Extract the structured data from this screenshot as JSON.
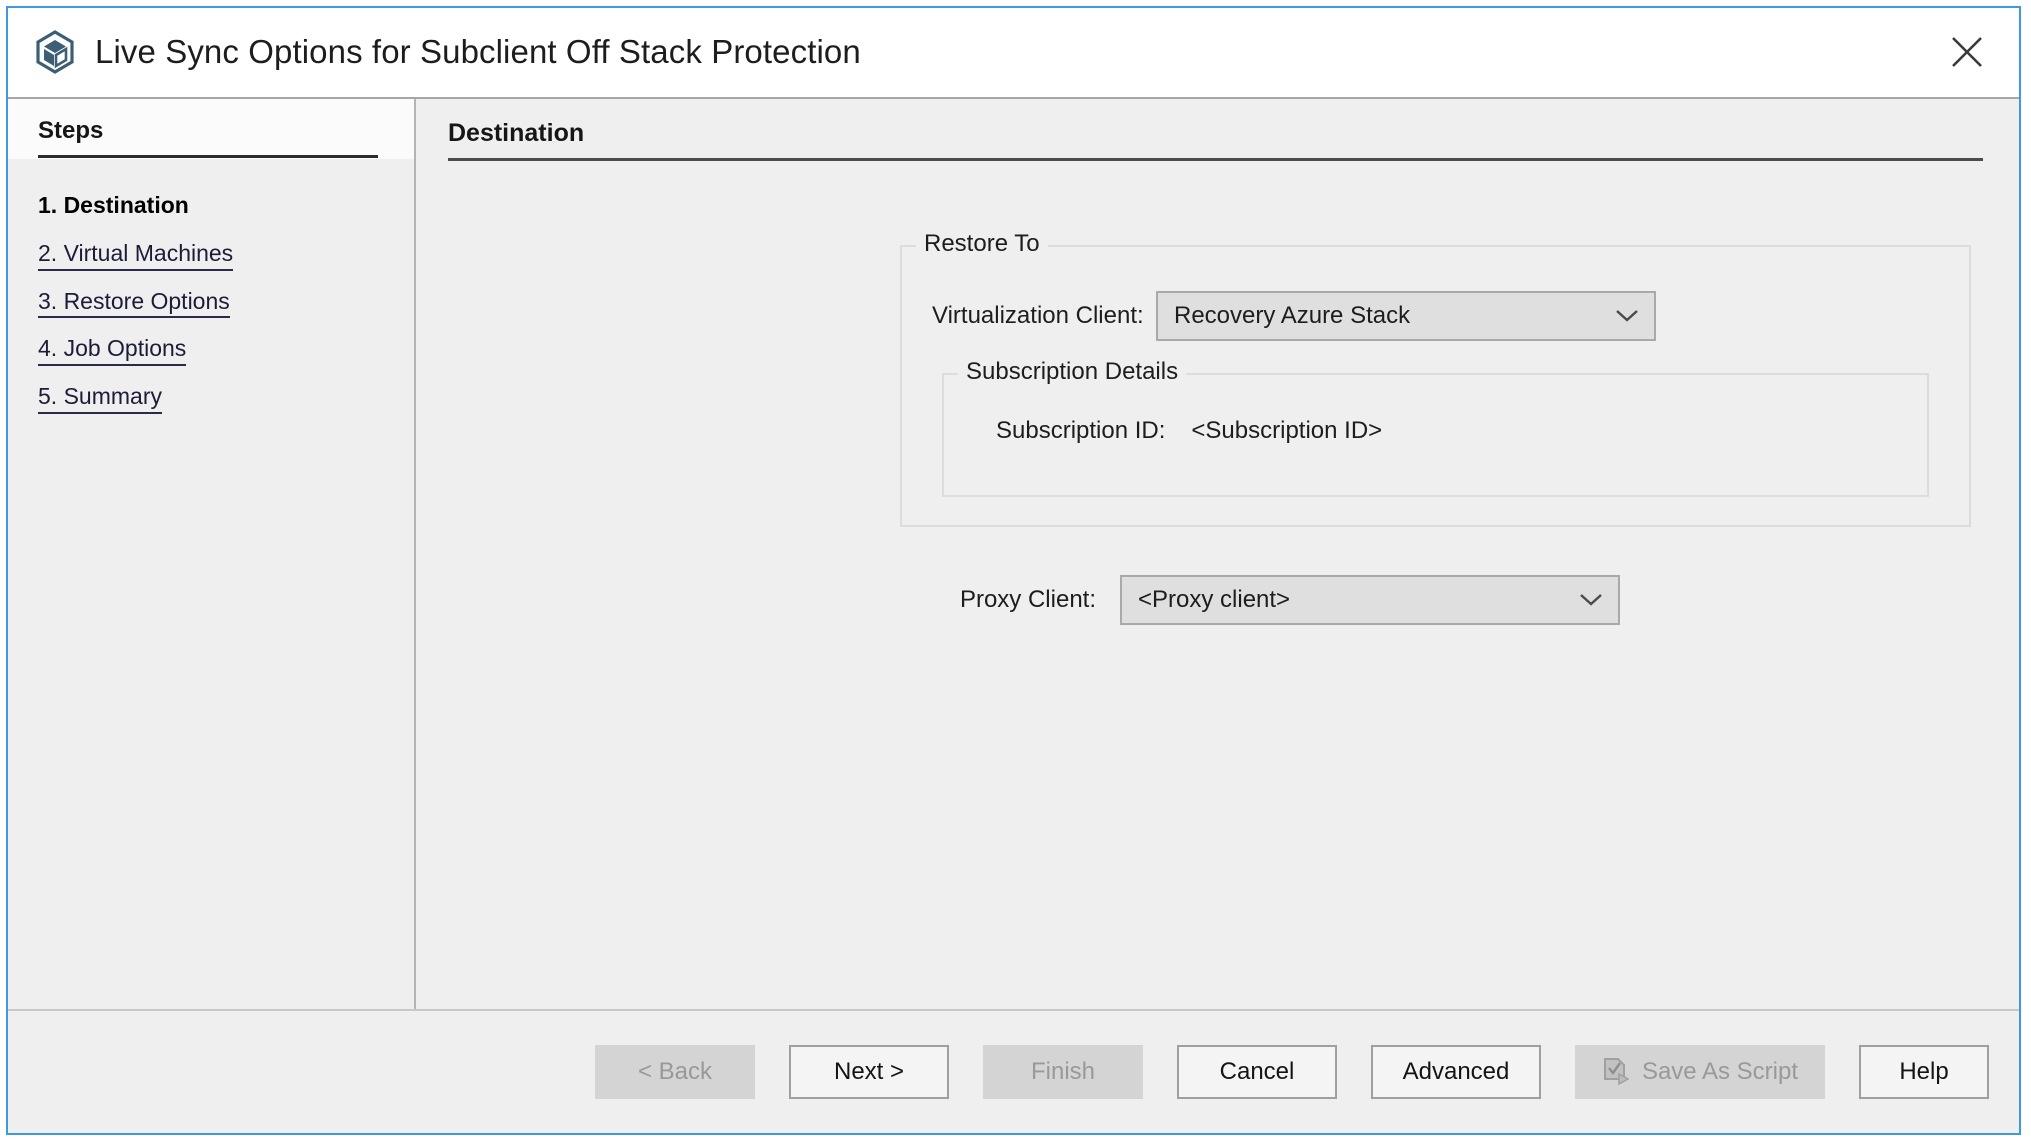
{
  "window": {
    "title": "Live Sync Options for Subclient Off Stack Protection",
    "app_icon": "commvault-cube-icon",
    "close_icon": "close-icon",
    "border_color": "#3d9ae0",
    "background_color": "#efefef"
  },
  "sidebar": {
    "header": "Steps",
    "items": [
      {
        "label": "1. Destination",
        "state": "current"
      },
      {
        "label": "2. Virtual Machines",
        "state": "link"
      },
      {
        "label": "3. Restore Options",
        "state": "link"
      },
      {
        "label": "4. Job Options",
        "state": "link"
      },
      {
        "label": "5. Summary",
        "state": "link"
      }
    ]
  },
  "main": {
    "heading": "Destination",
    "restore_to": {
      "title": "Restore To",
      "virtualization_client": {
        "label": "Virtualization Client:",
        "value": "Recovery Azure Stack",
        "chevron_icon": "chevron-down-icon"
      },
      "subscription_details": {
        "title": "Subscription Details",
        "subscription_id": {
          "label": "Subscription ID:",
          "value": "<Subscription ID>"
        }
      }
    },
    "proxy_client": {
      "label": "Proxy Client:",
      "value": "<Proxy client>",
      "chevron_icon": "chevron-down-icon"
    }
  },
  "footer": {
    "buttons": [
      {
        "label": "< Back",
        "enabled": false
      },
      {
        "label": "Next >",
        "enabled": true
      },
      {
        "label": "Finish",
        "enabled": false
      },
      {
        "label": "Cancel",
        "enabled": true
      },
      {
        "label": "Advanced",
        "enabled": true
      },
      {
        "label": "Save As Script",
        "enabled": false,
        "icon": "script-document-icon"
      },
      {
        "label": "Help",
        "enabled": true
      }
    ]
  }
}
